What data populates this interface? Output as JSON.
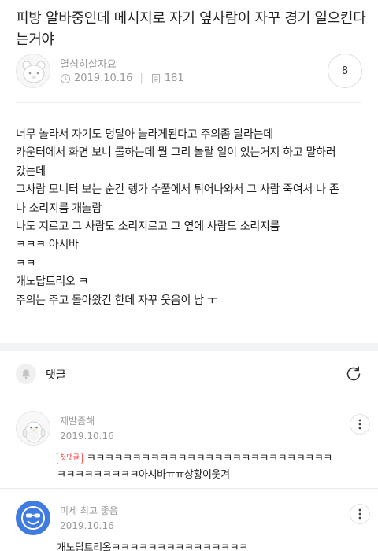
{
  "post": {
    "title": "피방 알바중인데 메시지로 자기 옆사람이 자꾸 경기 일으킨다는거야",
    "author": "열심히살자요",
    "date": "2019.10.16",
    "views": "181",
    "comment_count": "8",
    "body_lines": [
      "너무 놀라서 자기도 덩달아 놀라게된다고 주의좀 달라는데",
      "카운터에서 화면 보니 롤하는데 뭘 그리 놀랄 일이 있는거지 하고 말하러",
      "갔는데",
      "그사람 모니터 보는 순간 렝가 수풀에서 튀어나와서 그 사람 죽여서 나 존",
      "나 소리지름 개놀람",
      "나도 지르고 그 사람도 소리지르고 그 옆에 사람도 소리지름",
      "ㅋㅋㅋ 아시바",
      "ㅋㅋ",
      "개노답트리오 ㅋ",
      "주의는 주고 돌아왔긴 한데 자꾸 웃음이 남 ㅜ"
    ]
  },
  "comments_section": {
    "label": "댓글"
  },
  "comments": [
    {
      "author": "제발좀해",
      "date": "2019.10.16",
      "badge": "첫댓글",
      "lines": [
        "ㅋㅋㅋㅋㅋㅋㅋㅋㅋㅋㅋㅋㅋㅋㅋㅋㅋㅋㅋㅋㅋㅋㅋㅋㅋㅋㅋ",
        "ㅋㅋㅋㅋㅋㅋㅋㅋㅋ아시바ㅠㅠ상황이웃겨"
      ]
    },
    {
      "author": "미세 최고 좋음",
      "date": "2019.10.16",
      "lines": [
        "개노답트리옼ㅋㅋㅋㅋㅋㅋㅋㅋㅋㅋㅋㅋㅋㅋㅋ"
      ]
    }
  ],
  "icons": {
    "author_avatar": "bear-face-avatar",
    "date": "clock-icon",
    "views": "document-icon",
    "notifications": "bell-icon",
    "refresh": "refresh-icon",
    "more": "more-vertical-icon",
    "comment_avatar_1": "penguin-avatar",
    "comment_avatar_2": "smiley-sunglasses-avatar"
  },
  "colors": {
    "meta_gray": "#9a9a9a",
    "badge_red": "#ff4a4a",
    "smiley_blue": "#3f7be0"
  }
}
